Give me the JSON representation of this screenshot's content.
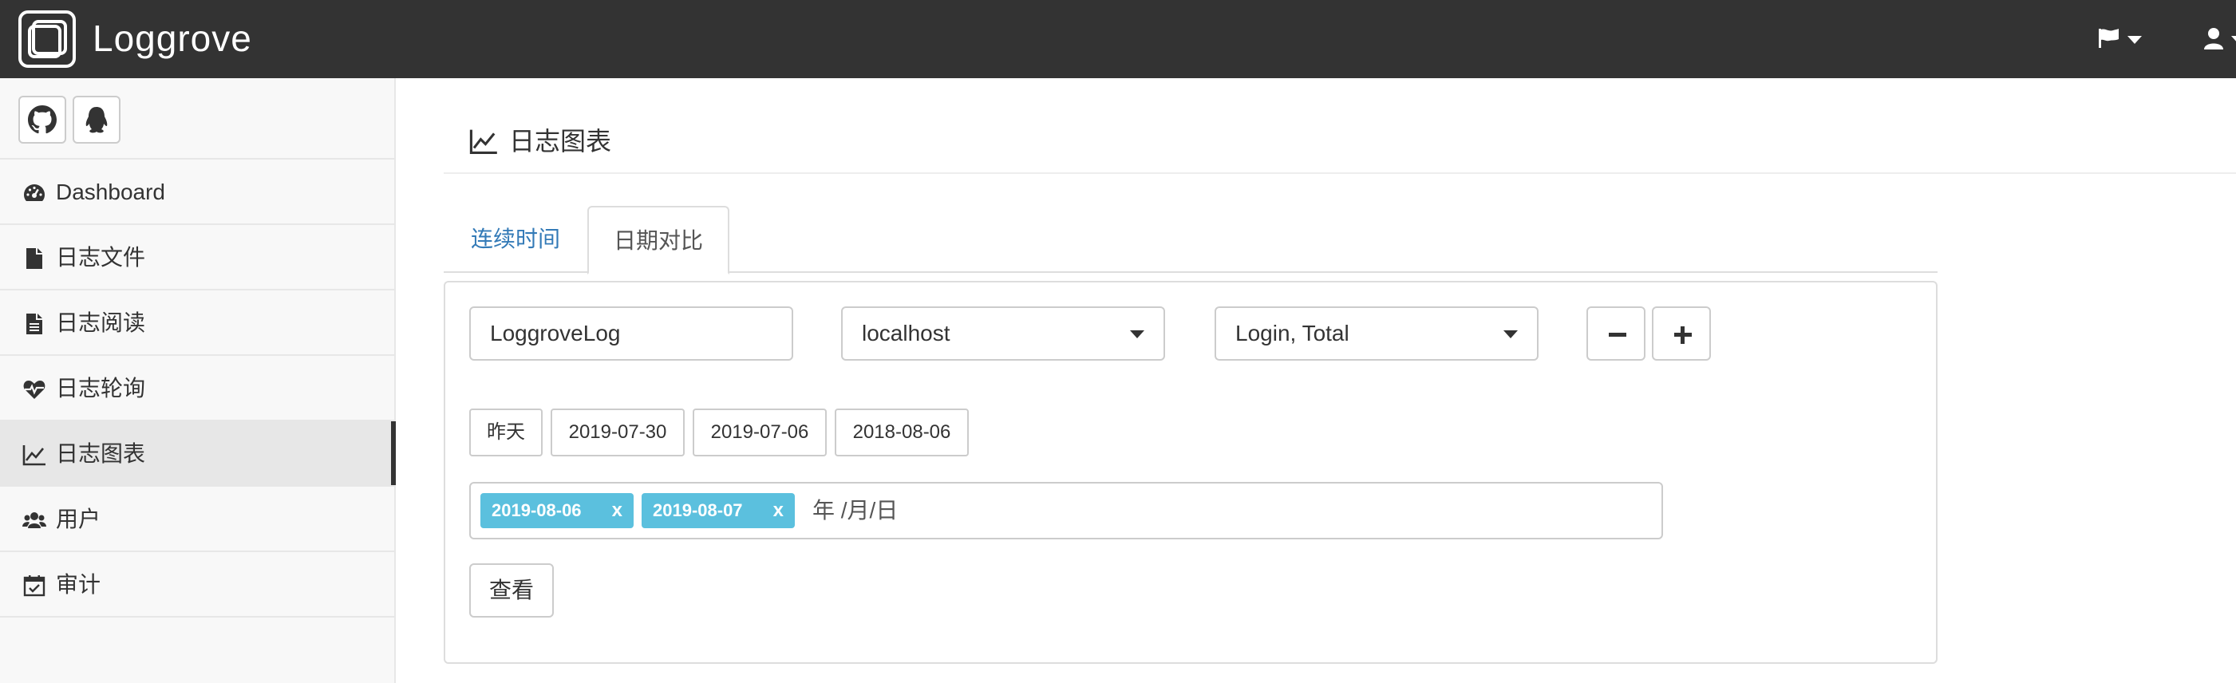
{
  "app": {
    "brand": "Loggrove",
    "navbar": {
      "icons": [
        "flag-icon",
        "user-icon"
      ]
    }
  },
  "sidebar": {
    "social_buttons": [
      {
        "icon": "github-icon"
      },
      {
        "icon": "qq-penguin-icon"
      }
    ],
    "items": [
      {
        "label": "Dashboard",
        "icon": "dashboard-icon"
      },
      {
        "label": "日志文件",
        "icon": "file-icon"
      },
      {
        "label": "日志阅读",
        "icon": "file-text-icon"
      },
      {
        "label": "日志轮询",
        "icon": "heartbeat-icon"
      },
      {
        "label": "日志图表",
        "icon": "line-chart-icon",
        "active": true
      },
      {
        "label": "用户",
        "icon": "users-icon"
      },
      {
        "label": "审计",
        "icon": "calendar-check-icon"
      }
    ]
  },
  "main": {
    "page_title": "日志图表",
    "tabs": [
      {
        "label": "连续时间",
        "active": false
      },
      {
        "label": "日期对比",
        "active": true
      }
    ],
    "form": {
      "log_input_value": "LoggroveLog",
      "host_select": "localhost",
      "metrics_select": "Login, Total",
      "quick_dates": [
        "昨天",
        "2019-07-30",
        "2019-07-06",
        "2018-08-06"
      ],
      "selected_dates": [
        "2019-08-06",
        "2019-08-07"
      ],
      "tag_remove": "x",
      "date_placeholder": "年 /月/日",
      "view_button": "查看"
    },
    "colors": {
      "tag": "#5bc0de",
      "link": "#337ab7",
      "navbar": "#333333"
    }
  }
}
